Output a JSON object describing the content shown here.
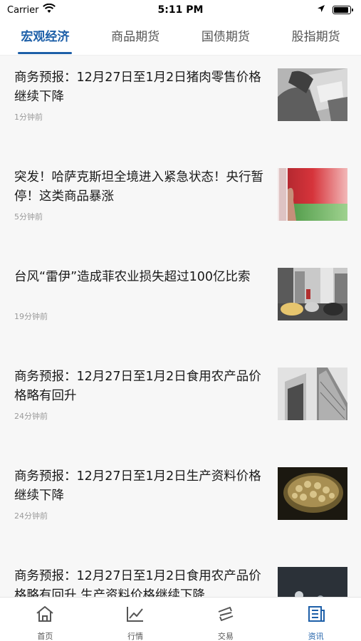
{
  "status_bar": {
    "carrier": "Carrier",
    "time": "5:11 PM",
    "battery_level": 0.9,
    "icons": [
      "wifi-icon",
      "location-arrow-icon",
      "battery-icon"
    ]
  },
  "tabs": [
    {
      "label": "宏观经济",
      "active": true
    },
    {
      "label": "商品期货",
      "active": false
    },
    {
      "label": "国债期货",
      "active": false
    },
    {
      "label": "股指期货",
      "active": false
    }
  ],
  "news": [
    {
      "title": "商务预报：12月27日至1月2日猪肉零售价格继续下降",
      "time": "1分钟前",
      "thumb": "hands-writing-photo"
    },
    {
      "title": "突发！哈萨克斯坦全境进入紧急状态！央行暂停！这类商品暴涨",
      "time": "5分钟前",
      "thumb": "flag-photo"
    },
    {
      "title": "台风“雷伊”造成菲农业损失超过100亿比索",
      "time": "19分钟前",
      "thumb": "city-traffic-photo"
    },
    {
      "title": "商务预报：12月27日至1月2日食用农产品价格略有回升",
      "time": "24分钟前",
      "thumb": "skyscraper-photo"
    },
    {
      "title": "商务预报：12月27日至1月2日生产资料价格继续下降",
      "time": "24分钟前",
      "thumb": "coins-photo"
    },
    {
      "title": "商务预报：12月27日至1月2日食用农产品价格略有回升 生产资料价格继续下降",
      "time": "",
      "thumb": "chess-photo"
    }
  ],
  "bottom_nav": [
    {
      "label": "首页",
      "icon": "home-icon",
      "active": false
    },
    {
      "label": "行情",
      "icon": "chart-icon",
      "active": false
    },
    {
      "label": "交易",
      "icon": "trade-icon",
      "active": false
    },
    {
      "label": "资讯",
      "icon": "news-icon",
      "active": true
    }
  ],
  "colors": {
    "accent": "#1d5fa8",
    "background": "#f7f7f7",
    "muted_text": "#9a9a9a"
  }
}
